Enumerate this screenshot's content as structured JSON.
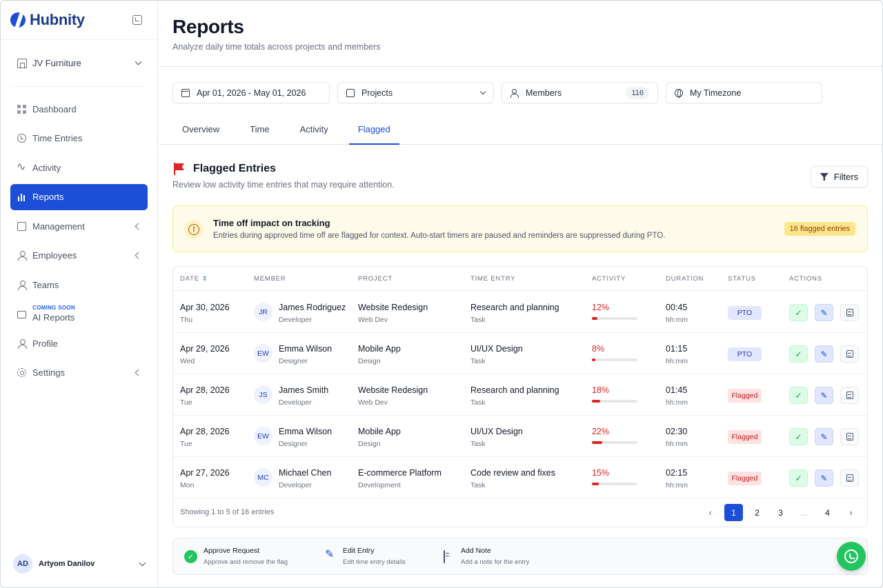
{
  "app": {
    "name": "Hubnity"
  },
  "sidebar": {
    "workspace": "JV Furniture",
    "items": [
      {
        "label": "Dashboard",
        "icon": "grid-icon"
      },
      {
        "label": "Time Entries",
        "icon": "history-icon"
      },
      {
        "label": "Activity",
        "icon": "pulse-icon"
      },
      {
        "label": "Reports",
        "icon": "bar-chart-icon",
        "active": true
      },
      {
        "label": "Management",
        "icon": "briefcase-icon",
        "expandable": true
      },
      {
        "label": "Employees",
        "icon": "user-icon",
        "expandable": true
      },
      {
        "label": "Teams",
        "icon": "user-icon"
      },
      {
        "label": "AI Reports",
        "badge": "COMING SOON",
        "icon": "bag-icon"
      },
      {
        "label": "Profile",
        "icon": "user-icon"
      },
      {
        "label": "Settings",
        "icon": "gear-icon",
        "expandable": true
      }
    ],
    "user": {
      "initials": "AD",
      "name": "Artyom Danilov"
    }
  },
  "header": {
    "title": "Reports",
    "subtitle": "Analyze daily time totals across projects and members"
  },
  "filters": {
    "date_range": "Apr 01, 2026 - May 01, 2026",
    "projects": "Projects",
    "members": "Members",
    "members_count": "116",
    "timezone": "My Timezone"
  },
  "tabs": [
    {
      "label": "Overview"
    },
    {
      "label": "Time"
    },
    {
      "label": "Activity"
    },
    {
      "label": "Flagged",
      "active": true
    }
  ],
  "section": {
    "title": "Flagged Entries",
    "subtitle": "Review low activity time entries that may require attention.",
    "filters_button": "Filters"
  },
  "notice": {
    "title": "Time off impact on tracking",
    "text": "Entries during approved time off are flagged for context. Auto-start timers are paused and reminders are suppressed during PTO.",
    "pill": "16 flagged entries"
  },
  "table": {
    "columns": [
      "DATE",
      "MEMBER",
      "PROJECT",
      "TIME ENTRY",
      "ACTIVITY",
      "DURATION",
      "STATUS",
      "ACTIONS"
    ],
    "rows": [
      {
        "date": "Apr 30, 2026",
        "day": "Thu",
        "initials": "JR",
        "member": "James Rodriguez",
        "role": "Developer",
        "project": "Website Redesign",
        "project_sub": "Web Dev",
        "entry": "Research and planning",
        "entry_type": "Task",
        "activity": "12%",
        "activity_value": 12,
        "duration": "00:45",
        "duration_unit": "hh:mm",
        "status": "PTO"
      },
      {
        "date": "Apr 29, 2026",
        "day": "Wed",
        "initials": "EW",
        "member": "Emma Wilson",
        "role": "Designer",
        "project": "Mobile App",
        "project_sub": "Design",
        "entry": "UI/UX Design",
        "entry_type": "Task",
        "activity": "8%",
        "activity_value": 8,
        "duration": "01:15",
        "duration_unit": "hh:mm",
        "status": "PTO"
      },
      {
        "date": "Apr 28, 2026",
        "day": "Tue",
        "initials": "JS",
        "member": "James Smith",
        "role": "Developer",
        "project": "Website Redesign",
        "project_sub": "Web Dev",
        "entry": "Research and planning",
        "entry_type": "Task",
        "activity": "18%",
        "activity_value": 18,
        "duration": "01:45",
        "duration_unit": "hh:mm",
        "status": "Flagged"
      },
      {
        "date": "Apr 28, 2026",
        "day": "Tue",
        "initials": "EW",
        "member": "Emma Wilson",
        "role": "Designer",
        "project": "Mobile App",
        "project_sub": "Design",
        "entry": "UI/UX Design",
        "entry_type": "Task",
        "activity": "22%",
        "activity_value": 22,
        "duration": "02:30",
        "duration_unit": "hh:mm",
        "status": "Flagged"
      },
      {
        "date": "Apr 27, 2026",
        "day": "Mon",
        "initials": "MC",
        "member": "Michael Chen",
        "role": "Developer",
        "project": "E-commerce Platform",
        "project_sub": "Development",
        "entry": "Code review and fixes",
        "entry_type": "Task",
        "activity": "15%",
        "activity_value": 15,
        "duration": "02:15",
        "duration_unit": "hh:mm",
        "status": "Flagged"
      }
    ]
  },
  "pagination": {
    "showing": "Showing 1 to 5 of 16 entries",
    "pages": [
      "1",
      "2",
      "3",
      "...",
      "4"
    ],
    "current": "1",
    "prev": "‹",
    "next": "›"
  },
  "legend": [
    {
      "title": "Approve Request",
      "sub": "Approve and remove the flag"
    },
    {
      "title": "Edit Entry",
      "sub": "Edit time entry details"
    },
    {
      "title": "Add Note",
      "sub": "Add a note for the entry"
    }
  ],
  "colors": {
    "accent": "#1d4ed8",
    "danger": "#dc2626",
    "success": "#22c55e",
    "warning_bg": "#fffbeb"
  }
}
